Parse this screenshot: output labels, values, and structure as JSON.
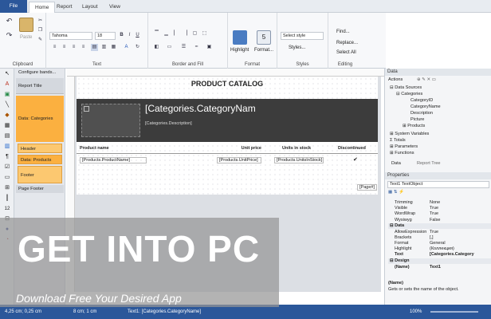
{
  "tabs": {
    "file": "File",
    "home": "Home",
    "report": "Report",
    "layout": "Layout",
    "view": "View"
  },
  "ribbon": {
    "clipboard_label": "Clipboard",
    "paste": "Paste",
    "font_name": "Tahoma",
    "font_size": "18",
    "text_label": "Text",
    "border_fill_label": "Border and Fill",
    "highlight": "Highlight",
    "format": "Format...",
    "format_label": "Format",
    "style_select": "Select style",
    "styles_btn": "Styles...",
    "styles_label": "Styles",
    "find": "Find...",
    "replace": "Replace...",
    "select_all": "Select All",
    "editing_label": "Editing"
  },
  "bands": {
    "configure": "Configure bands...",
    "report_title": "Report Title",
    "data_categories": "Data: Categories",
    "header": "Header",
    "data_products": "Data: Products",
    "footer": "Footer",
    "page_footer": "Page Footer"
  },
  "report": {
    "title": "PRODUCT CATALOG",
    "category_name": "[Categories.CategoryNam",
    "category_desc": "[Categories.Description]",
    "col_product": "Product name",
    "col_price": "Unit price",
    "col_stock": "Units in stock",
    "col_disc": "Discontinued",
    "f_product": "[Products.ProductName]",
    "f_price": "[Products.UnitPrice]",
    "f_stock": "[Products.UnitsInStock]",
    "page": "[Page#]"
  },
  "data_panel": {
    "header": "Data",
    "actions": "Actions",
    "data_sources": "Data Sources",
    "categories": "Categories",
    "category_id": "CategoryID",
    "category_name": "CategoryName",
    "description": "Description",
    "picture": "Picture",
    "products": "Products",
    "system_variables": "System Variables",
    "totals": "Totals",
    "parameters": "Parameters",
    "functions": "Functions",
    "tab_data": "Data",
    "tab_tree": "Report Tree"
  },
  "properties": {
    "header": "Properties",
    "object": "Text1  TextObject",
    "rows": [
      {
        "k": "Trimming",
        "v": "None"
      },
      {
        "k": "Visible",
        "v": "True"
      },
      {
        "k": "WordWrap",
        "v": "True"
      },
      {
        "k": "Wysiwyg",
        "v": "False"
      }
    ],
    "cat_data": "Data",
    "rows2": [
      {
        "k": "AllowExpression",
        "v": "True"
      },
      {
        "k": "Brackets",
        "v": "[,]"
      },
      {
        "k": "Format",
        "v": "General"
      },
      {
        "k": "Highlight",
        "v": "(Коллекция)"
      },
      {
        "k": "Text",
        "v": "[Categories.Category"
      }
    ],
    "cat_design": "Design",
    "name_row": {
      "k": "(Name)",
      "v": "Text1"
    },
    "desc_title": "(Name)",
    "desc_text": "Gets or sets the name of the object."
  },
  "status": {
    "pos": "4,25 cm; 0,25 cm",
    "size": "8 cm; 1 cm",
    "text": "Text1: [Categories.CategoryName]",
    "zoom": "100%"
  },
  "watermark": {
    "get": "GET ",
    "into": "INTO",
    "pc": " PC",
    "sub": "Download Free Your Desired App"
  },
  "colors": {
    "accent": "#2b579a",
    "band_orange": "#fbb040",
    "header_dark": "#3c3c3c"
  }
}
